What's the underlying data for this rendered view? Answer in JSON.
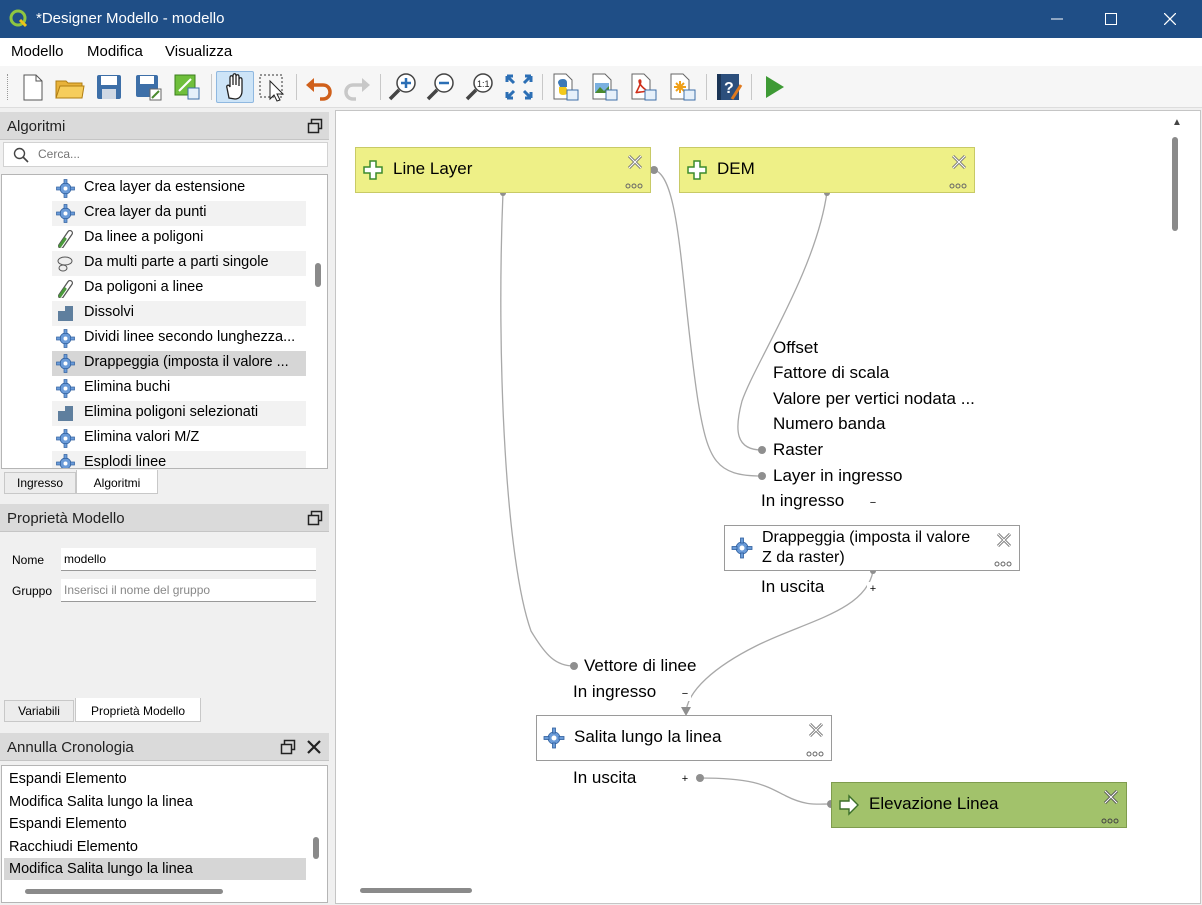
{
  "window": {
    "title": "*Designer Modello - modello",
    "controls": {
      "minimize": "minimize-icon",
      "maximize": "maximize-icon",
      "close": "close-icon"
    }
  },
  "menubar": [
    "Modello",
    "Modifica",
    "Visualizza"
  ],
  "toolbar": [
    {
      "icon": "new-model-icon"
    },
    {
      "icon": "open-model-icon"
    },
    {
      "icon": "save-model-icon"
    },
    {
      "icon": "save-as-icon"
    },
    {
      "icon": "export-icon"
    },
    {
      "icon": "pan-hand-icon",
      "active": true
    },
    {
      "icon": "select-cursor-icon"
    },
    {
      "icon": "undo-icon"
    },
    {
      "icon": "redo-icon"
    },
    {
      "icon": "zoom-in-icon"
    },
    {
      "icon": "zoom-out-icon"
    },
    {
      "icon": "zoom-actual-icon"
    },
    {
      "icon": "zoom-full-icon"
    },
    {
      "icon": "export-python-icon"
    },
    {
      "icon": "export-image-icon"
    },
    {
      "icon": "export-pdf-icon"
    },
    {
      "icon": "export-svg-icon"
    },
    {
      "icon": "help-icon"
    },
    {
      "icon": "run-icon"
    }
  ],
  "algorithms_panel": {
    "title": "Algoritmi",
    "search_placeholder": "Cerca...",
    "items": [
      {
        "label": "Crea layer da estensione",
        "icon": "gear-icon"
      },
      {
        "label": "Crea layer da punti",
        "icon": "gear-icon"
      },
      {
        "label": "Da linee a poligoni",
        "icon": "lines-to-polygons-icon"
      },
      {
        "label": "Da multi parte a parti singole",
        "icon": "multipart-icon"
      },
      {
        "label": "Da poligoni a linee",
        "icon": "polygons-to-lines-icon"
      },
      {
        "label": "Dissolvi",
        "icon": "dissolve-icon"
      },
      {
        "label": "Dividi linee secondo lunghezza...",
        "icon": "gear-icon"
      },
      {
        "label": "Drappeggia (imposta il valore ...",
        "icon": "gear-icon",
        "selected": true
      },
      {
        "label": "Elimina buchi",
        "icon": "gear-icon"
      },
      {
        "label": "Elimina poligoni selezionati",
        "icon": "dissolve-icon"
      },
      {
        "label": "Elimina valori M/Z",
        "icon": "gear-icon"
      },
      {
        "label": "Esplodi linee",
        "icon": "gear-icon"
      }
    ],
    "tabs": [
      "Ingresso",
      "Algoritmi"
    ]
  },
  "model_properties": {
    "title": "Proprietà Modello",
    "name_label": "Nome",
    "name_value": "modello",
    "group_label": "Gruppo",
    "group_placeholder": "Inserisci il nome del gruppo",
    "tabs": [
      "Variabili",
      "Proprietà Modello"
    ]
  },
  "history": {
    "title": "Annulla Cronologia",
    "items": [
      "Espandi Elemento",
      "Modifica Salita lungo la linea",
      "Espandi Elemento",
      "Racchiudi Elemento",
      "Modifica Salita lungo la linea"
    ]
  },
  "canvas": {
    "nodes": {
      "line_layer": "Line Layer",
      "dem": "DEM",
      "drape": "Drappeggia (imposta il valore Z da raster)",
      "climb": "Salita lungo la linea",
      "output": "Elevazione Linea"
    },
    "drape_params": [
      "Offset",
      "Fattore di scala",
      "Valore per vertici nodata ...",
      "Numero banda",
      "Raster",
      "Layer in ingresso"
    ],
    "drape_inputs_label": "In ingresso",
    "drape_outputs_label": "In uscita",
    "climb_params": [
      "Vettore di linee"
    ],
    "climb_inputs_label": "In ingresso",
    "climb_outputs_label": "In uscita",
    "minus": "−",
    "plus": "+"
  },
  "colors": {
    "titlebar": "#1f4e86",
    "input_node": "#eef087",
    "output_node": "#a2c26b",
    "selected_row": "#d6d6d6"
  }
}
